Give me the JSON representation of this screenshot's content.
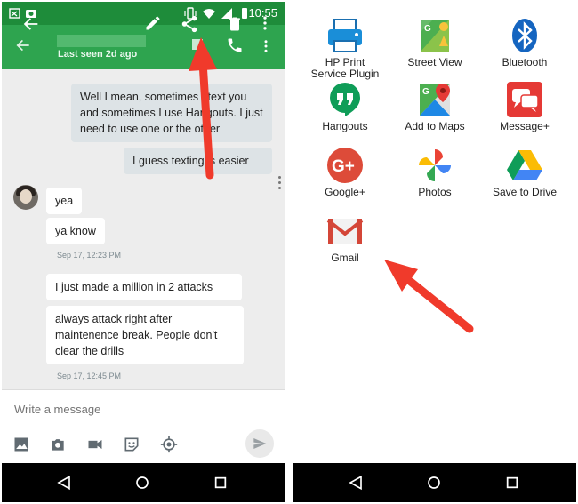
{
  "left_phone": {
    "status_bar": {
      "time": "10:55"
    },
    "app_bar": {
      "last_seen": "Last seen 2d ago"
    },
    "messages": [
      {
        "side": "out",
        "text": "Well I mean, sometimes I text you and sometimes I use Hangouts. I just need to use one or the other"
      },
      {
        "side": "out",
        "text": "I guess texting is easier"
      },
      {
        "side": "in",
        "text": "yea"
      },
      {
        "side": "in",
        "text": "ya know"
      },
      {
        "side": "in",
        "text": "I just made a million in 2 attacks"
      },
      {
        "side": "in",
        "text": "always attack right after maintenence break. People don't clear the drills"
      }
    ],
    "timestamps": [
      "Sep 17, 12:23 PM",
      "Sep 17, 12:45 PM"
    ],
    "compose": {
      "placeholder": "Write a message"
    }
  },
  "right_phone": {
    "share_targets": [
      {
        "label_line1": "HP Print",
        "label_line2": "Service Plugin",
        "icon": "hp-print-icon"
      },
      {
        "label_line1": "Street View",
        "label_line2": "",
        "icon": "street-view-icon"
      },
      {
        "label_line1": "Bluetooth",
        "label_line2": "",
        "icon": "bluetooth-icon"
      },
      {
        "label_line1": "Hangouts",
        "label_line2": "",
        "icon": "hangouts-icon"
      },
      {
        "label_line1": "Add to Maps",
        "label_line2": "",
        "icon": "maps-icon"
      },
      {
        "label_line1": "Message+",
        "label_line2": "",
        "icon": "message-plus-icon"
      },
      {
        "label_line1": "Google+",
        "label_line2": "",
        "icon": "google-plus-icon"
      },
      {
        "label_line1": "Photos",
        "label_line2": "",
        "icon": "photos-icon"
      },
      {
        "label_line1": "Save to Drive",
        "label_line2": "",
        "icon": "drive-icon"
      },
      {
        "label_line1": "Gmail",
        "label_line2": "",
        "icon": "gmail-icon"
      }
    ]
  },
  "colors": {
    "app_bar": "#2ea44f",
    "status_bar": "#1e8c3a",
    "annotation_arrow": "#f03a2b",
    "outgoing_bubble": "#dde3e6",
    "incoming_bubble": "#ffffff"
  }
}
